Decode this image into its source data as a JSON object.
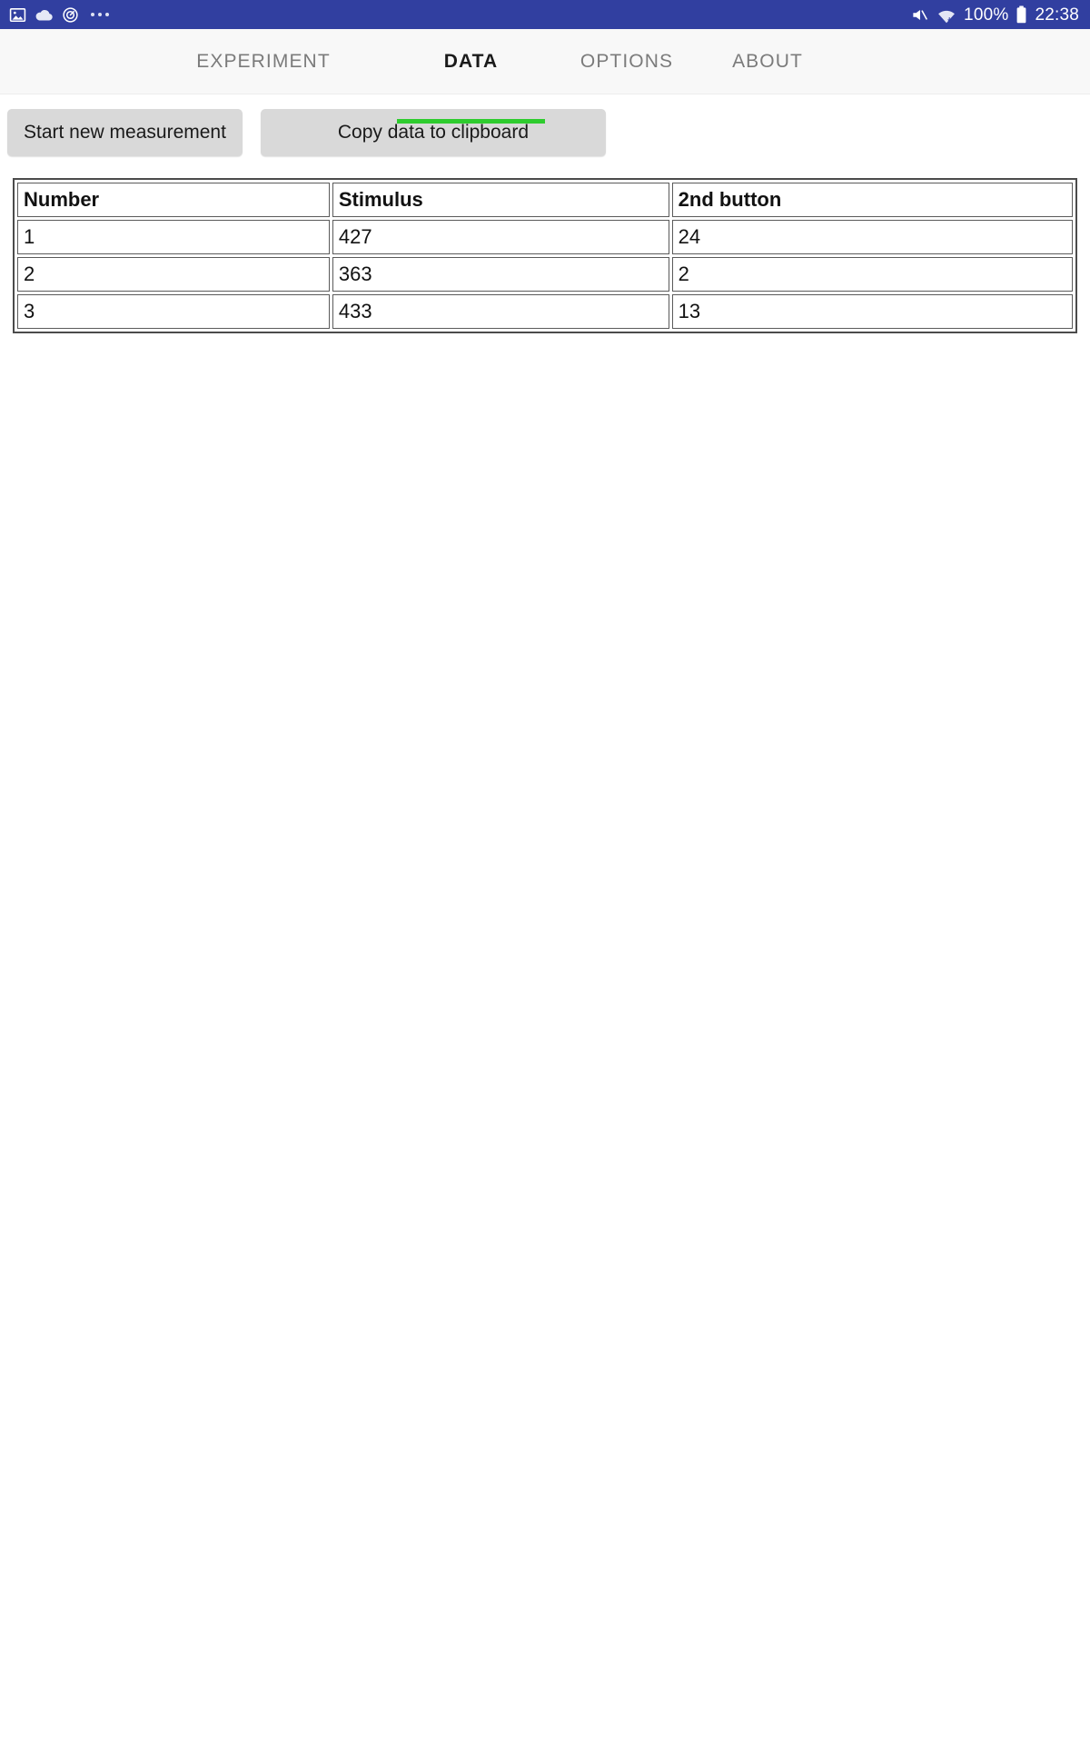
{
  "statusbar": {
    "icons_left": [
      "image-icon",
      "cloud-icon",
      "alarm-icon",
      "more-icon"
    ],
    "icons_right": [
      "mute-icon",
      "wifi-icon",
      "battery-icon"
    ],
    "battery_percent": "100%",
    "time": "22:38",
    "background_color": "#313fa0"
  },
  "tabs": [
    {
      "label": "EXPERIMENT",
      "active": false
    },
    {
      "label": "DATA",
      "active": true
    },
    {
      "label": "OPTIONS",
      "active": false
    },
    {
      "label": "ABOUT",
      "active": false
    }
  ],
  "tab_indicator_color": "#2ecc2e",
  "toolbar": {
    "start_label": "Start new measurement",
    "copy_label": "Copy data to clipboard"
  },
  "table": {
    "headers": [
      "Number",
      "Stimulus",
      "2nd button"
    ],
    "rows": [
      {
        "number": "1",
        "stimulus": "427",
        "second_button": "24"
      },
      {
        "number": "2",
        "stimulus": "363",
        "second_button": "2"
      },
      {
        "number": "3",
        "stimulus": "433",
        "second_button": "13"
      }
    ]
  }
}
